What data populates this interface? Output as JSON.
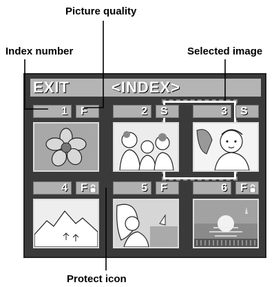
{
  "callouts": {
    "picture_quality": "Picture quality",
    "index_number": "Index number",
    "selected_image": "Selected image",
    "protect_icon": "Protect icon"
  },
  "screen": {
    "exit_label": "EXIT",
    "title": "<INDEX>"
  },
  "cells": [
    {
      "number": "1",
      "quality": "F",
      "protected": false,
      "selected": false,
      "image": "flower"
    },
    {
      "number": "2",
      "quality": "S",
      "protected": false,
      "selected": false,
      "image": "family"
    },
    {
      "number": "3",
      "quality": "S",
      "protected": false,
      "selected": true,
      "image": "girl-on-phone"
    },
    {
      "number": "4",
      "quality": "F",
      "protected": true,
      "selected": false,
      "image": "mountains"
    },
    {
      "number": "5",
      "quality": "F",
      "protected": false,
      "selected": false,
      "image": "beach-woman"
    },
    {
      "number": "6",
      "quality": "F",
      "protected": true,
      "selected": false,
      "image": "sunset"
    }
  ]
}
